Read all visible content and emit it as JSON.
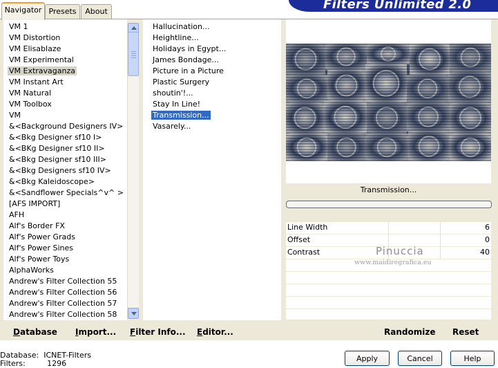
{
  "tabs": [
    "Navigator",
    "Presets",
    "About"
  ],
  "active_tab": "Navigator",
  "banner_title": "Filters Unlimited 2.0",
  "categories": {
    "items": [
      "VM 1",
      "VM Distortion",
      "VM Elisablaze",
      "VM Experimental",
      "VM Extravaganza",
      "VM Instant Art",
      "VM Natural",
      "VM Toolbox",
      "VM",
      "&<Background Designers IV>",
      "&<Bkg Designer sf10 I>",
      "&<BKg Designer sf10 II>",
      "&<Bkg Designer sf10 III>",
      "&<Bkg Designers sf10 IV>",
      "&<Bkg Kaleidoscope>",
      "&<Sandflower Specials^v^ >",
      "[AFS IMPORT]",
      "AFH",
      "Alf's Border FX",
      "Alf's Power Grads",
      "Alf's Power Sines",
      "Alf's Power Toys",
      "AlphaWorks",
      "Andrew's Filter Collection 55",
      "Andrew's Filter Collection 56",
      "Andrew's Filter Collection 57",
      "Andrew's Filter Collection 58"
    ],
    "selected": "VM Extravaganza"
  },
  "filters": {
    "items": [
      "Hallucination...",
      "Heightline...",
      "Holidays in Egypt...",
      "James Bondage...",
      "Picture in a Picture",
      "Plastic Surgery",
      "shoutin'!...",
      "Stay In Line!",
      "Transmission...",
      "Vasarely..."
    ],
    "selected": "Transmission..."
  },
  "preview": {
    "filter_label": "Transmission..."
  },
  "params": [
    {
      "label": "Line Width",
      "value": "6"
    },
    {
      "label": "Offset",
      "value": "0"
    },
    {
      "label": "Contrast",
      "value": "40"
    }
  ],
  "watermark": {
    "name": "Pinuccia",
    "url": "www.maidiregrafica.eu"
  },
  "toolbar": {
    "database": {
      "u": "D",
      "rest": "atabase"
    },
    "import": {
      "u": "I",
      "rest": "mport..."
    },
    "filter_info": {
      "u": "F",
      "rest": "ilter Info..."
    },
    "editor": {
      "u": "E",
      "rest": "ditor..."
    },
    "randomize": "Randomize",
    "reset": "Reset"
  },
  "status": {
    "database_label": "Database:",
    "database_value": "ICNET-Filters",
    "filters_label": "Filters:",
    "filters_value": "1296"
  },
  "buttons": {
    "apply": "Apply",
    "cancel": "Cancel",
    "help": "Help"
  },
  "colors": {
    "banner": "#1c2c9a",
    "selection": "#316ac5",
    "panel": "#ece9d8",
    "active_tab_accent": "#f0a030"
  }
}
